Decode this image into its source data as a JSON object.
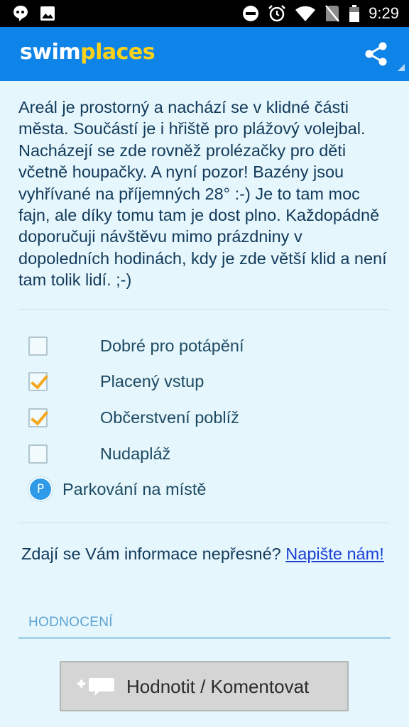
{
  "status_bar": {
    "time": "9:29",
    "icons": [
      "chat-bubble-icon",
      "image-icon",
      "do-not-disturb-icon",
      "alarm-icon",
      "wifi-icon",
      "no-sim-icon",
      "battery-icon"
    ]
  },
  "app_bar": {
    "logo_part1": "swim",
    "logo_part2": "places",
    "share_icon": "share-icon"
  },
  "description": "Areál je prostorný a nachází se v klidné části města. Součástí je i hřiště pro plážový volejbal. Nacházejí se zde rovněž prolézačky pro děti včetně houpačky. A nyní pozor! Bazény jsou vyhřívané na příjemných 28° :-) Je to tam moc fajn, ale díky tomu tam je dost plno. Každopádně doporučuji návštěvu mimo prázdniny v dopoledních hodinách, kdy je zde větší klid a není tam tolik lidí. ;-)",
  "features": [
    {
      "label": "Dobré pro potápění",
      "checked": false
    },
    {
      "label": "Placený vstup",
      "checked": true
    },
    {
      "label": "Občerstvení poblíž",
      "checked": true
    },
    {
      "label": "Nudapláž",
      "checked": false
    }
  ],
  "parking": {
    "icon_letter": "P",
    "label": "Parkování na místě"
  },
  "feedback": {
    "text": "Zdají se Vám informace nepřesné? ",
    "link": "Napište nám!"
  },
  "rating": {
    "section_title": "HODNOCENÍ",
    "button_label": "Hodnotit / Komentovat"
  },
  "colors": {
    "accent": "#0f84e8",
    "logo_yellow": "#ffd21a",
    "check": "#f6a71c",
    "background": "#e5f6fc"
  }
}
